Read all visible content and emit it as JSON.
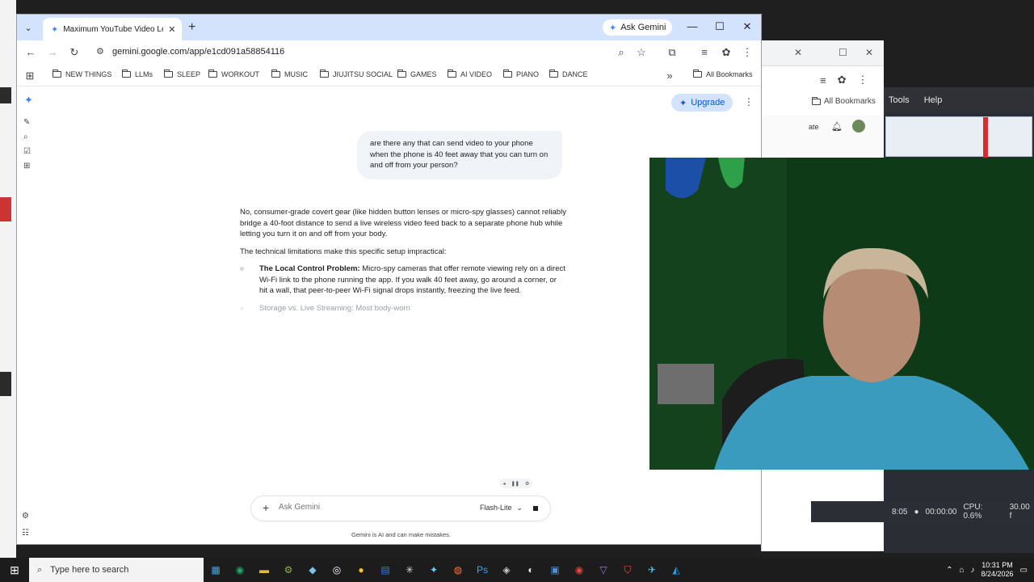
{
  "browser": {
    "tab_title": "Maximum YouTube Video Leng",
    "ask_gemini": "Ask Gemini",
    "url": "gemini.google.com/app/e1cd091a58854116",
    "bookmarks": [
      "NEW THINGS",
      "LLMs",
      "SLEEP",
      "WORKOUT",
      "MUSIC",
      "JIUJITSU SOCIAL",
      "GAMES",
      "AI VIDEO",
      "PIANO",
      "DANCE"
    ],
    "all_bookmarks": "All Bookmarks"
  },
  "gemini": {
    "upgrade": "Upgrade",
    "user_message": "are there any that can send video to your phone when the phone is 40 feet away that you can turn on and off from your person?",
    "response_intro": "No, consumer-grade covert gear (like hidden button lenses or micro-spy glasses) cannot reliably bridge a 40-foot distance to send a live wireless video feed back to a separate phone hub while letting you turn it on and off from your body.",
    "response_lead": "The technical limitations make this specific setup impractical:",
    "bullets": [
      {
        "title": "The Local Control Problem:",
        "text": " Micro-spy cameras that offer remote viewing rely on a direct Wi-Fi link to the phone running the app. If you walk 40 feet away, go around a corner, or hit a wall, that peer-to-peer Wi-Fi signal drops instantly, freezing the live feed."
      },
      {
        "title": "Storage vs. Live Streaming:",
        "text": " Most body-worn"
      }
    ],
    "input_placeholder": "Ask Gemini",
    "model": "Flash-Lite",
    "disclaimer": "Gemini is AI and can make mistakes."
  },
  "background": {
    "menu_tools": "Tools",
    "menu_help": "Help",
    "all_bookmarks": "All Bookmarks",
    "ate_fragment": "ate",
    "status_time": "8:05",
    "status_timer": "00:00:00",
    "status_cpu": "CPU: 0.6%",
    "status_fps": "30.00 f"
  },
  "taskbar": {
    "search_placeholder": "Type here to search",
    "time": "10:31 PM",
    "date": "8/24/2026"
  },
  "colors": {
    "tab_strip": "#d3e3fd",
    "gemini_blue": "#4285f4",
    "upgrade_bg": "#d3e3fd",
    "webcam_wall": "#14421c",
    "taskbar": "#1c1c1c"
  }
}
